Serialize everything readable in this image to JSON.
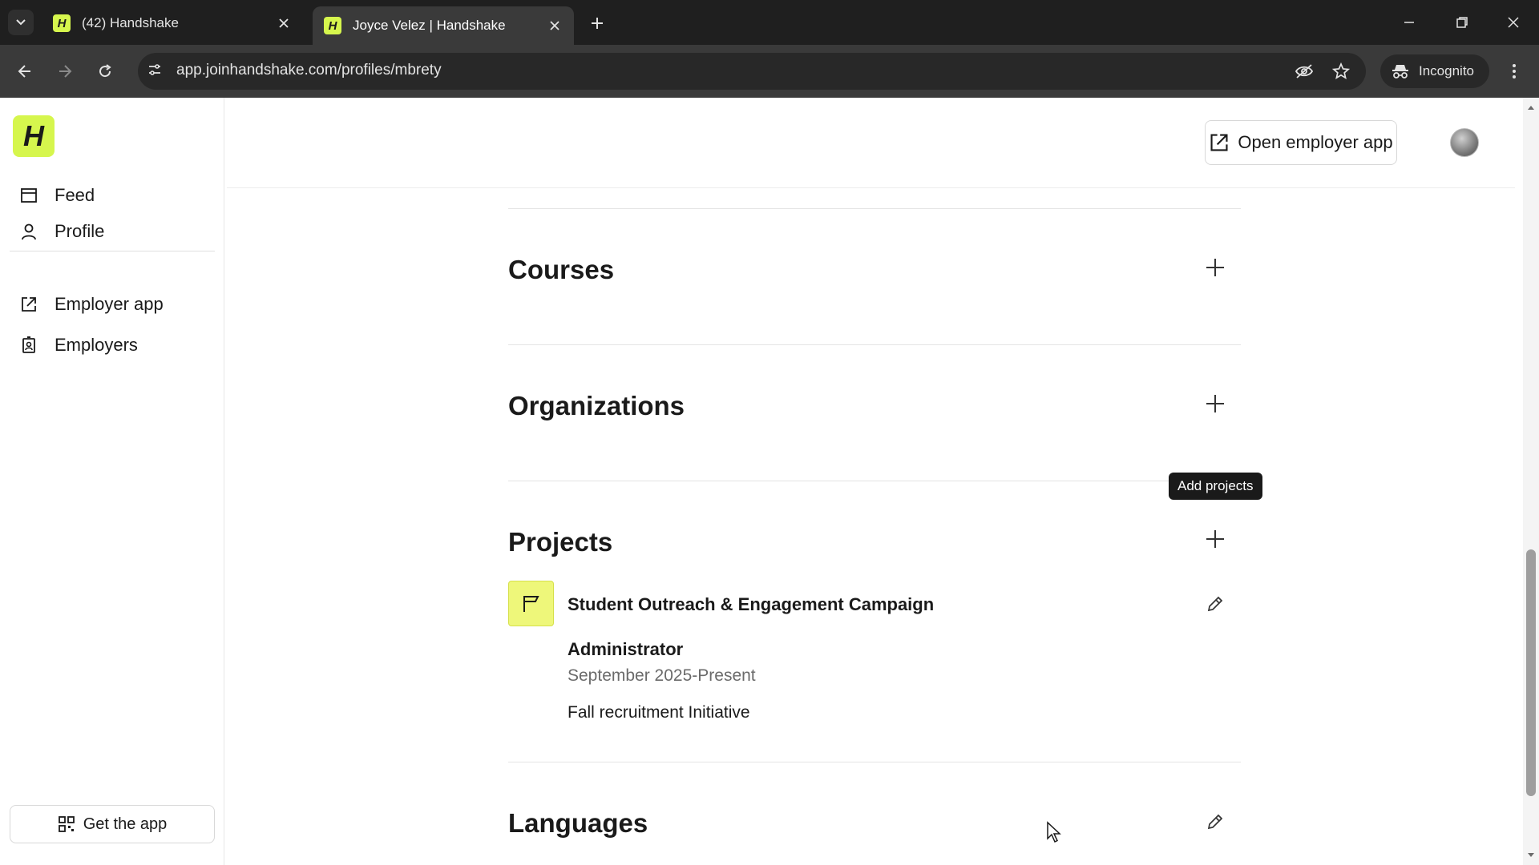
{
  "browser": {
    "tabs": [
      {
        "title": "(42) Handshake",
        "favicon": "H"
      },
      {
        "title": "Joyce Velez | Handshake",
        "favicon": "H"
      }
    ],
    "url": "app.joinhandshake.com/profiles/mbrety",
    "incognito_label": "Incognito"
  },
  "sidebar": {
    "logo": "H",
    "items": [
      {
        "label": "Feed",
        "icon": "feed-icon"
      },
      {
        "label": "Profile",
        "icon": "person-icon"
      },
      {
        "label": "Employer app",
        "icon": "external-link-icon"
      },
      {
        "label": "Employers",
        "icon": "badge-icon"
      }
    ],
    "get_app_label": "Get the app"
  },
  "header": {
    "open_employer_label": "Open employer app"
  },
  "sections": {
    "courses": {
      "title": "Courses"
    },
    "organizations": {
      "title": "Organizations"
    },
    "projects": {
      "title": "Projects",
      "tooltip": "Add projects",
      "item": {
        "name": "Student Outreach & Engagement Campaign",
        "role": "Administrator",
        "dates": "September 2025-Present",
        "description": "Fall recruitment Initiative"
      }
    },
    "languages": {
      "title": "Languages"
    }
  },
  "colors": {
    "brand": "#d6f64d",
    "project_icon_bg": "#eef77a",
    "chrome_dark": "#1f1f1f"
  }
}
